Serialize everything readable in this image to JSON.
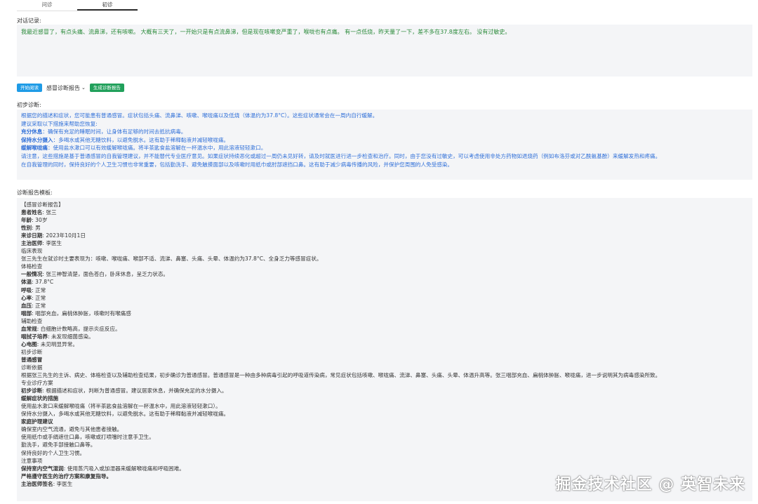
{
  "tabs": [
    {
      "label": "问诊"
    },
    {
      "label": "初诊"
    }
  ],
  "dialog": {
    "label": "对话记录:",
    "text": "我最近感冒了，有点头痛、流鼻涕，还有咳嗽。 大概有三天了，一开始只是有点流鼻涕，但是现在咳嗽变严重了，喉咙也有点痛。 有一点低烧，昨天量了一下，差不多在37.8度左右。 没有过敏史。"
  },
  "toolbar": {
    "start": "开始阅读",
    "select": "感冒诊断报告",
    "generate": "生成诊断报告"
  },
  "diagnosis": {
    "label": "初步诊断:",
    "lines": [
      {
        "k": "",
        "v": "根据您的描述和症状，您可能患有普通感冒。症状包括头痛、流鼻涕、咳嗽、喉咙痛以及低烧（体温约为37.8°C）。这些症状通常会在一周内自行缓解。"
      },
      {
        "k": "",
        "v": "建议采取以下措施来帮助您恢复:"
      },
      {
        "k": "充分休息",
        "v": "：确保有充足的睡眠时间，让身体有足够的时间去抵抗病毒。"
      },
      {
        "k": "保持水分摄入",
        "v": "：多喝水或其他无糖饮料，以避免脱水。这有助于稀释黏液并减轻喉咙痛。"
      },
      {
        "k": "缓解喉咙痛",
        "v": "：使用盐水漱口可以有效缓解喉咙痛。将半茶匙食盐溶解在一杯温水中，用此溶液轻轻漱口。"
      },
      {
        "k": "",
        "v": "请注意，这些措施是基于普通感冒的自我管理建议，并不能替代专业医疗意见。如果症状持续恶化或超过一周仍未见好转，请及时就医进行进一步检查和治疗。同时，由于您没有过敏史，可以考虑使用非处方药物如退烧药（例如布洛芬或对乙酰氨基酚）来缓解发热和疼痛。"
      },
      {
        "k": "",
        "v": "在自我管理的同时，保持良好的个人卫生习惯也非常重要，包括勤洗手、避免触摸面部以及咳嗽时用纸巾或肘部遮挡口鼻。这有助于减少病毒传播的风险，并保护您周围的人免受感染。"
      }
    ]
  },
  "template": {
    "label": "诊断报告模板:",
    "lines": [
      {
        "k": "",
        "v": "【感冒诊断报告】"
      },
      {
        "k": "患者姓名",
        "v": ": 张三"
      },
      {
        "k": "年龄",
        "v": ": 30岁"
      },
      {
        "k": "性别",
        "v": ": 男"
      },
      {
        "k": "来诊日期",
        "v": ": 2023年10月1日"
      },
      {
        "k": "主治医师",
        "v": ": 李医生"
      },
      {
        "k": "",
        "v": "临床表现"
      },
      {
        "k": "",
        "v": "张三先生在就诊时主要表现为：咳嗽、喉咙痛、喉部不适、流涕、鼻塞、头痛、头晕、体温约为37.8°C、全身乏力等感冒症状。"
      },
      {
        "k": "",
        "v": "体格检查"
      },
      {
        "k": "一般情况",
        "v": ": 张三神智清楚，面色苍白，卧床休息，呈乏力状态。"
      },
      {
        "k": "体温",
        "v": ": 37.8°C"
      },
      {
        "k": "呼吸",
        "v": ": 正常"
      },
      {
        "k": "心率",
        "v": ": 正常"
      },
      {
        "k": "血压",
        "v": ": 正常"
      },
      {
        "k": "咽部",
        "v": ": 咽部充血，扁桃体肿胀，咳嗽时有喉痛感"
      },
      {
        "k": "",
        "v": "辅助检查"
      },
      {
        "k": "血常规",
        "v": ": 白细胞计数略高，提示炎症反应。"
      },
      {
        "k": "咽拭子培养",
        "v": ": 未发现细菌感染。"
      },
      {
        "k": "心电图",
        "v": ": 未见明显异常。"
      },
      {
        "k": "",
        "v": "初步诊断"
      },
      {
        "k": "普通感冒",
        "v": ""
      },
      {
        "k": "",
        "v": "诊断依据"
      },
      {
        "k": "",
        "v": "根据张三先生的主诉、病史、体格检查以及辅助检查结果，初步确诊为普通感冒。普通感冒是一种由多种病毒引起的呼吸道传染病，常见症状包括咳嗽、喉咙痛、流涕、鼻塞、头痛、头晕、体温升高等。张三咽部充血、扁桃体肿胀、喉咙痛，进一步说明其为病毒感染所致。",
        "wrap": true
      },
      {
        "k": "",
        "v": "专业诊疗方案"
      },
      {
        "k": "初步诊断",
        "v": ": 根据描述和症状，判断为普通感冒。建议居家休息，并确保充足的水分摄入。"
      },
      {
        "k": "缓解症状的措施",
        "v": ""
      },
      {
        "k": "",
        "v": "使用盐水漱口来缓解喉咙痛（将半茶匙食盐溶解在一杯温水中，用此溶液轻轻漱口）。"
      },
      {
        "k": "",
        "v": "保持水分摄入，多喝水或其他无糖饮料，以避免脱水。这有助于稀释黏液并减轻喉咙痛。"
      },
      {
        "k": "家庭护理建议",
        "v": ""
      },
      {
        "k": "",
        "v": "确保室内空气流通，避免与其他患者接触。"
      },
      {
        "k": "",
        "v": "使用纸巾或手绢遮住口鼻，咳嗽或打喷嚏时注意手卫生。"
      },
      {
        "k": "",
        "v": "勤洗手，避免手部接触口鼻等。"
      },
      {
        "k": "",
        "v": "保持良好的个人卫生习惯。"
      },
      {
        "k": "",
        "v": "注意事项"
      },
      {
        "k": "保持室内空气湿润",
        "v": ": 使用蒸汽吸入或加湿器来缓解喉咙痛和呼吸困难。"
      },
      {
        "k": "严格遵守医生的治疗方案和康复指导。",
        "v": ""
      },
      {
        "k": "主治医师签名",
        "v": ": 李医生"
      }
    ]
  },
  "watermark": "掘金技术社区 @ 英智未来"
}
